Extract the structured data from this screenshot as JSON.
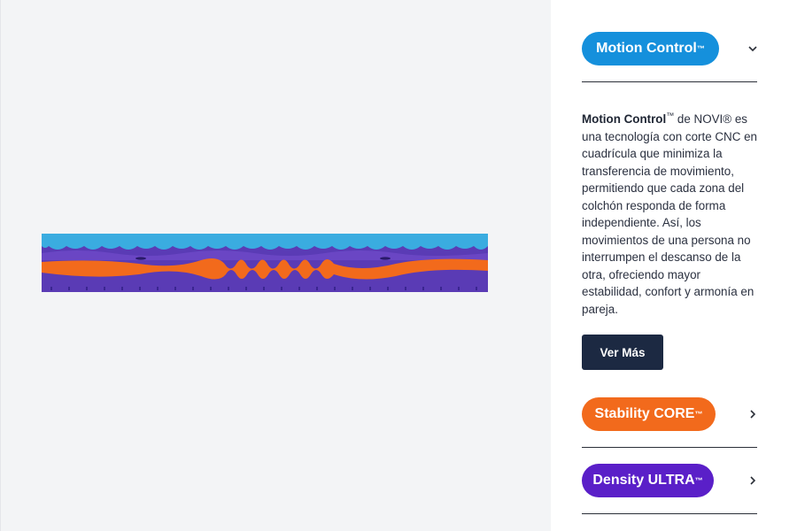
{
  "left": {
    "illustration": "mattress-layers-cross-section",
    "layer_colors": {
      "top_foam": "#3aace0",
      "mid_foam": "#6a46c4",
      "core": "#f26a1c",
      "base": "#5a3bb5"
    }
  },
  "accordion": {
    "items": [
      {
        "title": "Motion Control",
        "tm": "™",
        "color": "#1590dc",
        "expanded": true,
        "chevron": "chevron-down-icon"
      },
      {
        "title": "Stability CORE",
        "tm": "™",
        "color": "#f26a1c",
        "expanded": false,
        "chevron": "chevron-right-icon"
      },
      {
        "title": "Density ULTRA",
        "tm": "™",
        "color": "#5a1fc8",
        "expanded": false,
        "chevron": "chevron-right-icon"
      }
    ],
    "description": {
      "bold": "Motion Control",
      "tm": "™",
      "text": " de NOVI® es una tecnología con corte CNC en cuadrícula que minimiza la transferencia de movimiento, permitiendo que cada zona del colchón responda de forma independiente. Así, los movimientos de una persona no interrumpen el descanso de la otra, ofreciendo mayor estabilidad, confort y armonía en pareja."
    },
    "cta_label": "Ver Más",
    "cta_color": "#1c2942"
  }
}
